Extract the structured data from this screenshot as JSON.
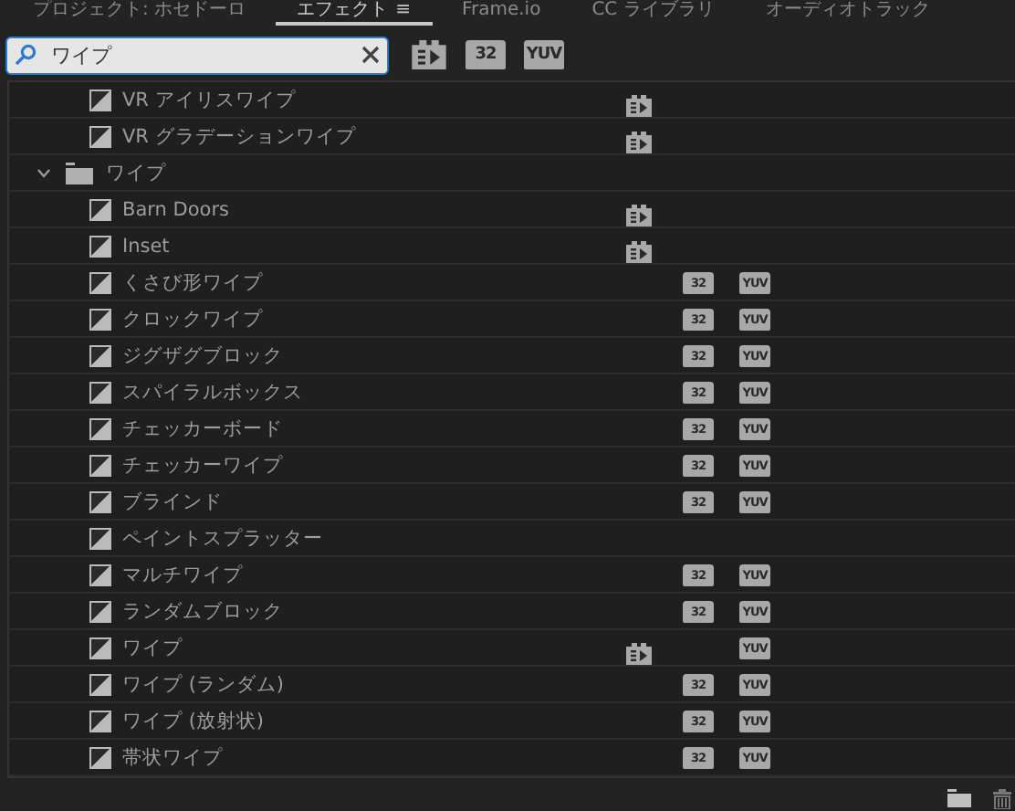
{
  "tabs": [
    {
      "label": "プロジェクト: ホセドーロ",
      "selected": false
    },
    {
      "label": "エフェクト",
      "selected": true,
      "menu": "≡"
    },
    {
      "label": "Frame.io",
      "selected": false
    },
    {
      "label": "CC ライブラリ",
      "selected": false
    },
    {
      "label": "オーディオトラック",
      "selected": false
    }
  ],
  "search": {
    "value": "ワイプ"
  },
  "filters": [
    {
      "kind": "accelerated"
    },
    {
      "kind": "bit32",
      "label": "32"
    },
    {
      "kind": "yuv",
      "label": "YUV"
    }
  ],
  "effects_above": [
    {
      "name": "VR アイリスワイプ",
      "badges": [
        {
          "kind": "accelerated"
        }
      ]
    },
    {
      "name": "VR グラデーションワイプ",
      "badges": [
        {
          "kind": "accelerated"
        }
      ]
    }
  ],
  "folders": [
    {
      "name": "ワイプ",
      "expanded": true,
      "children": [
        {
          "name": "Barn Doors",
          "badges": [
            {
              "kind": "accelerated"
            }
          ]
        },
        {
          "name": "Inset",
          "badges": [
            {
              "kind": "accelerated"
            }
          ]
        },
        {
          "name": "くさび形ワイプ",
          "badges": [
            {
              "kind": "bit32",
              "label": "32"
            },
            {
              "kind": "yuv",
              "label": "YUV"
            }
          ]
        },
        {
          "name": "クロックワイプ",
          "badges": [
            {
              "kind": "bit32",
              "label": "32"
            },
            {
              "kind": "yuv",
              "label": "YUV"
            }
          ]
        },
        {
          "name": "ジグザグブロック",
          "badges": [
            {
              "kind": "bit32",
              "label": "32"
            },
            {
              "kind": "yuv",
              "label": "YUV"
            }
          ]
        },
        {
          "name": "スパイラルボックス",
          "badges": [
            {
              "kind": "bit32",
              "label": "32"
            },
            {
              "kind": "yuv",
              "label": "YUV"
            }
          ]
        },
        {
          "name": "チェッカーボード",
          "badges": [
            {
              "kind": "bit32",
              "label": "32"
            },
            {
              "kind": "yuv",
              "label": "YUV"
            }
          ]
        },
        {
          "name": "チェッカーワイプ",
          "badges": [
            {
              "kind": "bit32",
              "label": "32"
            },
            {
              "kind": "yuv",
              "label": "YUV"
            }
          ]
        },
        {
          "name": "ブラインド",
          "badges": [
            {
              "kind": "bit32",
              "label": "32"
            },
            {
              "kind": "yuv",
              "label": "YUV"
            }
          ]
        },
        {
          "name": "ペイントスプラッター"
        },
        {
          "name": "マルチワイプ",
          "badges": [
            {
              "kind": "bit32",
              "label": "32"
            },
            {
              "kind": "yuv",
              "label": "YUV"
            }
          ]
        },
        {
          "name": "ランダムブロック",
          "badges": [
            {
              "kind": "bit32",
              "label": "32"
            },
            {
              "kind": "yuv",
              "label": "YUV"
            }
          ]
        },
        {
          "name": "ワイプ",
          "badges": [
            {
              "kind": "accelerated"
            },
            {
              "kind": "yuv",
              "label": "YUV"
            }
          ]
        },
        {
          "name": "ワイプ (ランダム)",
          "badges": [
            {
              "kind": "bit32",
              "label": "32"
            },
            {
              "kind": "yuv",
              "label": "YUV"
            }
          ]
        },
        {
          "name": "ワイプ (放射状)",
          "badges": [
            {
              "kind": "bit32",
              "label": "32"
            },
            {
              "kind": "yuv",
              "label": "YUV"
            }
          ]
        },
        {
          "name": "帯状ワイプ",
          "badges": [
            {
              "kind": "bit32",
              "label": "32"
            },
            {
              "kind": "yuv",
              "label": "YUV"
            }
          ]
        }
      ]
    }
  ]
}
